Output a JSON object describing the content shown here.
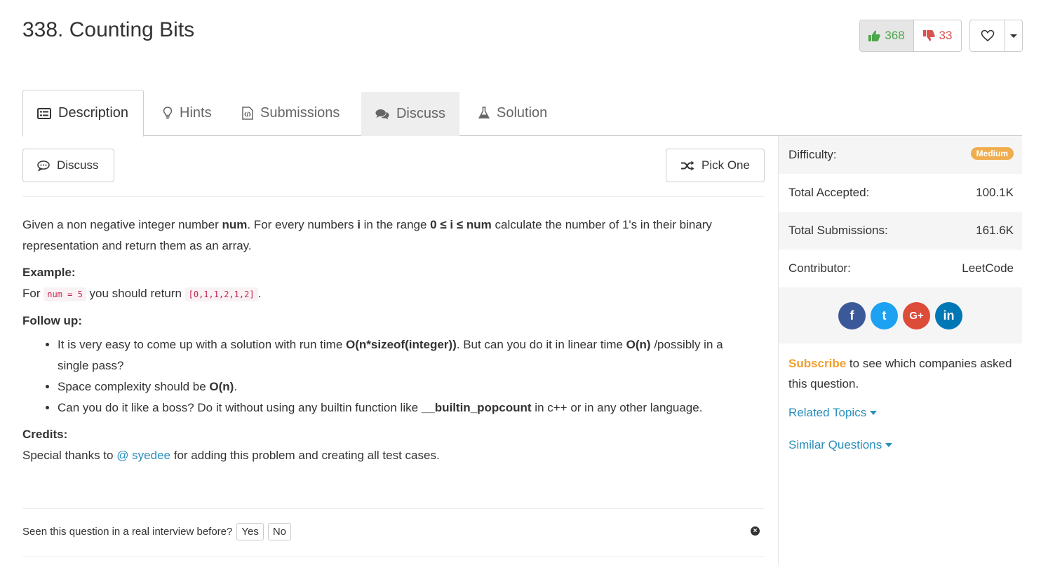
{
  "problem": {
    "title": "338. Counting Bits"
  },
  "votes": {
    "up": "368",
    "down": "33"
  },
  "tabs": [
    {
      "label": "Description"
    },
    {
      "label": "Hints"
    },
    {
      "label": "Submissions"
    },
    {
      "label": "Discuss"
    },
    {
      "label": "Solution"
    }
  ],
  "actions": {
    "discuss_label": "Discuss",
    "pick_one_label": "Pick One"
  },
  "description": {
    "p1_a": "Given a non negative integer number ",
    "p1_b": "num",
    "p1_c": ". For every numbers ",
    "p1_d": "i",
    "p1_e": " in the range ",
    "p1_f": "0 ≤ i ≤ num",
    "p1_g": " calculate the number of 1's in their binary representation and return them as an array.",
    "example_heading": "Example:",
    "example_a": "For ",
    "example_code1": "num = 5",
    "example_b": " you should return ",
    "example_code2": "[0,1,1,2,1,2]",
    "example_c": ".",
    "followup_heading": "Follow up:",
    "fu1_a": "It is very easy to come up with a solution with run time ",
    "fu1_b": "O(n*sizeof(integer))",
    "fu1_c": ". But can you do it in linear time ",
    "fu1_d": "O(n)",
    "fu1_e": " /possibly in a single pass?",
    "fu2_a": "Space complexity should be ",
    "fu2_b": "O(n)",
    "fu2_c": ".",
    "fu3_a": "Can you do it like a boss? Do it without using any builtin function like ",
    "fu3_b": "__builtin_popcount",
    "fu3_c": " in c++ or in any other language.",
    "credits_heading": "Credits:",
    "credits_a": "Special thanks to ",
    "credits_link": "@ syedee",
    "credits_b": " for adding this problem and creating all test cases."
  },
  "interview": {
    "question": "Seen this question in a real interview before?",
    "yes": "Yes",
    "no": "No"
  },
  "sidebar": {
    "difficulty_label": "Difficulty:",
    "difficulty_value": "Medium",
    "accepted_label": "Total Accepted:",
    "accepted_value": "100.1K",
    "submissions_label": "Total Submissions:",
    "submissions_value": "161.6K",
    "contributor_label": "Contributor:",
    "contributor_value": "LeetCode",
    "social": [
      "f",
      "t",
      "G+",
      "in"
    ],
    "subscribe_link": "Subscribe",
    "subscribe_text": " to see which companies asked this question.",
    "related_topics": "Related Topics",
    "similar_questions": "Similar Questions"
  },
  "colors": {
    "accent": "#2a8fbd",
    "medium": "#f0ad4e",
    "facebook": "#3b5998",
    "twitter": "#1da1f2",
    "google": "#dd4b39",
    "linkedin": "#0077b5"
  }
}
